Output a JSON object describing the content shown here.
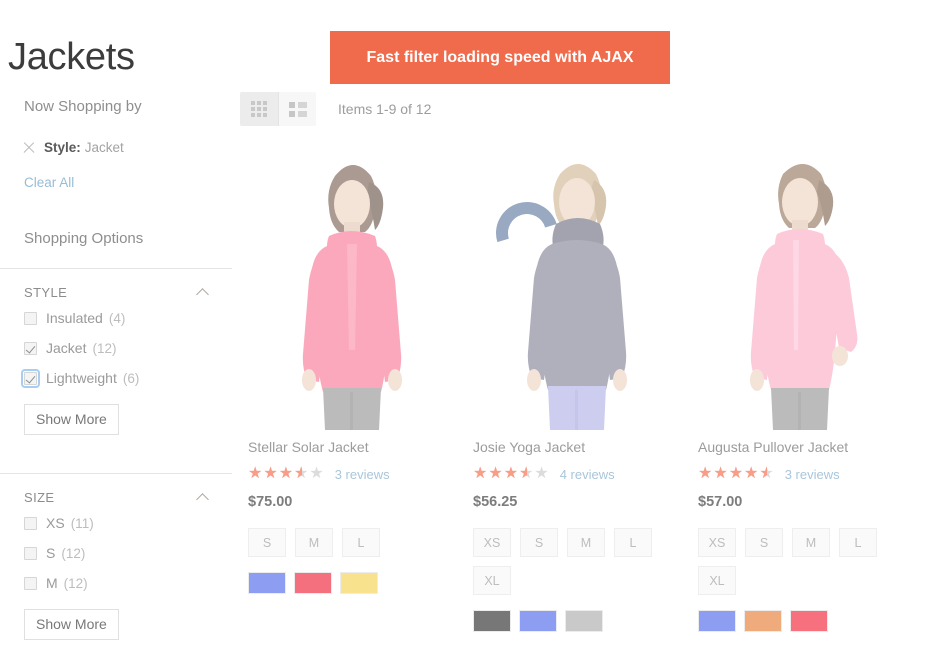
{
  "page": {
    "title": "Jackets"
  },
  "promo": {
    "text": "Fast filter loading speed with AJAX",
    "bg_color": "#f06a4c",
    "text_color": "#ffffff"
  },
  "sidebar": {
    "now_shopping_title": "Now Shopping by",
    "active_filters": [
      {
        "label": "Style:",
        "value": "Jacket",
        "remove_icon": "close-icon"
      }
    ],
    "clear_all_label": "Clear All",
    "shopping_options_title": "Shopping Options",
    "filter_blocks": [
      {
        "title": "STYLE",
        "collapse_icon": "chevron-up-icon",
        "options": [
          {
            "label": "Insulated",
            "count": "(4)",
            "checked": false,
            "focused": false
          },
          {
            "label": "Jacket",
            "count": "(12)",
            "checked": true,
            "focused": false
          },
          {
            "label": "Lightweight",
            "count": "(6)",
            "checked": true,
            "focused": true
          }
        ],
        "show_more_label": "Show More"
      },
      {
        "title": "SIZE",
        "collapse_icon": "chevron-up-icon",
        "options": [
          {
            "label": "XS",
            "count": "(11)",
            "checked": false,
            "focused": false
          },
          {
            "label": "S",
            "count": "(12)",
            "checked": false,
            "focused": false
          },
          {
            "label": "M",
            "count": "(12)",
            "checked": false,
            "focused": false
          }
        ],
        "show_more_label": "Show More"
      }
    ]
  },
  "toolbar": {
    "view_modes": [
      {
        "name": "grid-view",
        "icon": "grid-icon",
        "active": true
      },
      {
        "name": "list-view",
        "icon": "list-icon",
        "active": false
      }
    ],
    "items_count_text": "Items 1-9 of 12"
  },
  "products": [
    {
      "name": "Stellar Solar Jacket",
      "rating_percent": 70,
      "reviews_label": "3 reviews",
      "price": "$75.00",
      "sizes": [
        "S",
        "M",
        "L"
      ],
      "colors": [
        "#8d9ef2",
        "#f4707e",
        "#f8e28d"
      ],
      "photo": {
        "jacket_color": "#f96a8c",
        "pants_color": "#8b8b8b",
        "hair_color": "#6d5242"
      },
      "loading": false
    },
    {
      "name": "Josie Yoga Jacket",
      "rating_percent": 70,
      "reviews_label": "4 reviews",
      "price": "$56.25",
      "sizes": [
        "XS",
        "S",
        "M",
        "L",
        "XL"
      ],
      "colors": [
        "#777777",
        "#8d9ef2",
        "#c9c9c9"
      ],
      "photo": {
        "jacket_color": "#75778c",
        "pants_color": "#a7a9e4",
        "hair_color": "#cbb08a"
      },
      "loading": true,
      "spinner_color": "#2d4d80"
    },
    {
      "name": "Augusta Pullover Jacket",
      "rating_percent": 90,
      "reviews_label": "3 reviews",
      "price": "$57.00",
      "sizes": [
        "XS",
        "S",
        "M",
        "L",
        "XL"
      ],
      "colors": [
        "#8d9ef2",
        "#efab7c",
        "#f7707e"
      ],
      "photo": {
        "jacket_color": "#fba4c0",
        "pants_color": "#8b8b8b",
        "hair_color": "#8a6a4e"
      },
      "loading": false
    }
  ]
}
